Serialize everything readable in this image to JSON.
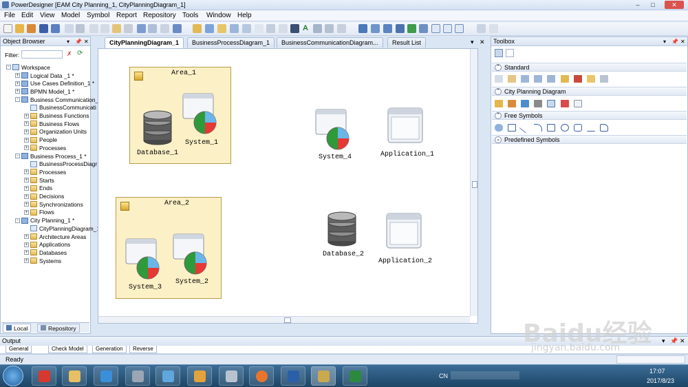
{
  "window": {
    "title": "PowerDesigner [EAM City Planning_1, CityPlanningDiagram_1]"
  },
  "menu": [
    "File",
    "Edit",
    "View",
    "Model",
    "Symbol",
    "Report",
    "Repository",
    "Tools",
    "Window",
    "Help"
  ],
  "browser": {
    "title": "Object Browser",
    "filter_label": "Filter:",
    "tree": [
      {
        "label": "Workspace",
        "level": 0,
        "kind": "ws",
        "pm": "-"
      },
      {
        "label": "Logical Data _1 *",
        "level": 1,
        "kind": "model",
        "pm": "+"
      },
      {
        "label": "Use Cases Definition_1 *",
        "level": 1,
        "kind": "model",
        "pm": "+"
      },
      {
        "label": "BPMN Model_1 *",
        "level": 1,
        "kind": "model",
        "pm": "+"
      },
      {
        "label": "Business Communication_",
        "level": 1,
        "kind": "model",
        "pm": "-"
      },
      {
        "label": "BusinessCommunicati",
        "level": 2,
        "kind": "diag",
        "pm": ""
      },
      {
        "label": "Business Functions",
        "level": 2,
        "kind": "folder",
        "pm": "+"
      },
      {
        "label": "Business Flows",
        "level": 2,
        "kind": "folder",
        "pm": "+"
      },
      {
        "label": "Organization Units",
        "level": 2,
        "kind": "folder",
        "pm": "+"
      },
      {
        "label": "People",
        "level": 2,
        "kind": "folder",
        "pm": "+"
      },
      {
        "label": "Processes",
        "level": 2,
        "kind": "folder",
        "pm": "+"
      },
      {
        "label": "Business Process_1 *",
        "level": 1,
        "kind": "model",
        "pm": "-"
      },
      {
        "label": "BusinessProcessDiagr",
        "level": 2,
        "kind": "diag",
        "pm": ""
      },
      {
        "label": "Processes",
        "level": 2,
        "kind": "folder",
        "pm": "+"
      },
      {
        "label": "Starts",
        "level": 2,
        "kind": "folder",
        "pm": "+"
      },
      {
        "label": "Ends",
        "level": 2,
        "kind": "folder",
        "pm": "+"
      },
      {
        "label": "Decisions",
        "level": 2,
        "kind": "folder",
        "pm": "+"
      },
      {
        "label": "Synchronizations",
        "level": 2,
        "kind": "folder",
        "pm": "+"
      },
      {
        "label": "Flows",
        "level": 2,
        "kind": "folder",
        "pm": "+"
      },
      {
        "label": "City Planning_1 *",
        "level": 1,
        "kind": "model",
        "pm": "-"
      },
      {
        "label": "CityPlanningDiagram_1",
        "level": 2,
        "kind": "diag",
        "pm": ""
      },
      {
        "label": "Architecture Areas",
        "level": 2,
        "kind": "folder",
        "pm": "+"
      },
      {
        "label": "Applications",
        "level": 2,
        "kind": "folder",
        "pm": "+"
      },
      {
        "label": "Databases",
        "level": 2,
        "kind": "folder",
        "pm": "+"
      },
      {
        "label": "Systems",
        "level": 2,
        "kind": "folder",
        "pm": "+"
      }
    ],
    "bottom_tabs": [
      "Local",
      "Repository"
    ]
  },
  "tabs": [
    "CityPlanningDiagram_1",
    "BusinessProcessDiagram_1",
    "BusinessCommunicationDiagram...",
    "Result List"
  ],
  "diagram": {
    "areas": [
      "Area_1",
      "Area_2"
    ],
    "symbols": {
      "database_1": "Database_1",
      "system_1": "System_1",
      "system_4": "System_4",
      "application_1": "Application_1",
      "system_3": "System_3",
      "system_2": "System_2",
      "database_2": "Database_2",
      "application_2": "Application_2"
    }
  },
  "toolbox": {
    "title": "Toolbox",
    "sections": [
      "Standard",
      "City Planning Diagram",
      "Free Symbols",
      "Predefined Symbols"
    ]
  },
  "output": {
    "title": "Output",
    "tabs": [
      "General",
      "Check Model",
      "Generation",
      "Reverse"
    ]
  },
  "status": {
    "text": "Ready"
  },
  "taskbar": {
    "time": "17:07",
    "date": "2017/8/23",
    "lang": "CN"
  },
  "watermark": {
    "text": "Baidu经验",
    "url": "jingyan.baidu.com"
  },
  "colors": {
    "area_fill": "#fcf0c6",
    "accent": "#4f76ad",
    "taskbar": "#2a5a82"
  }
}
